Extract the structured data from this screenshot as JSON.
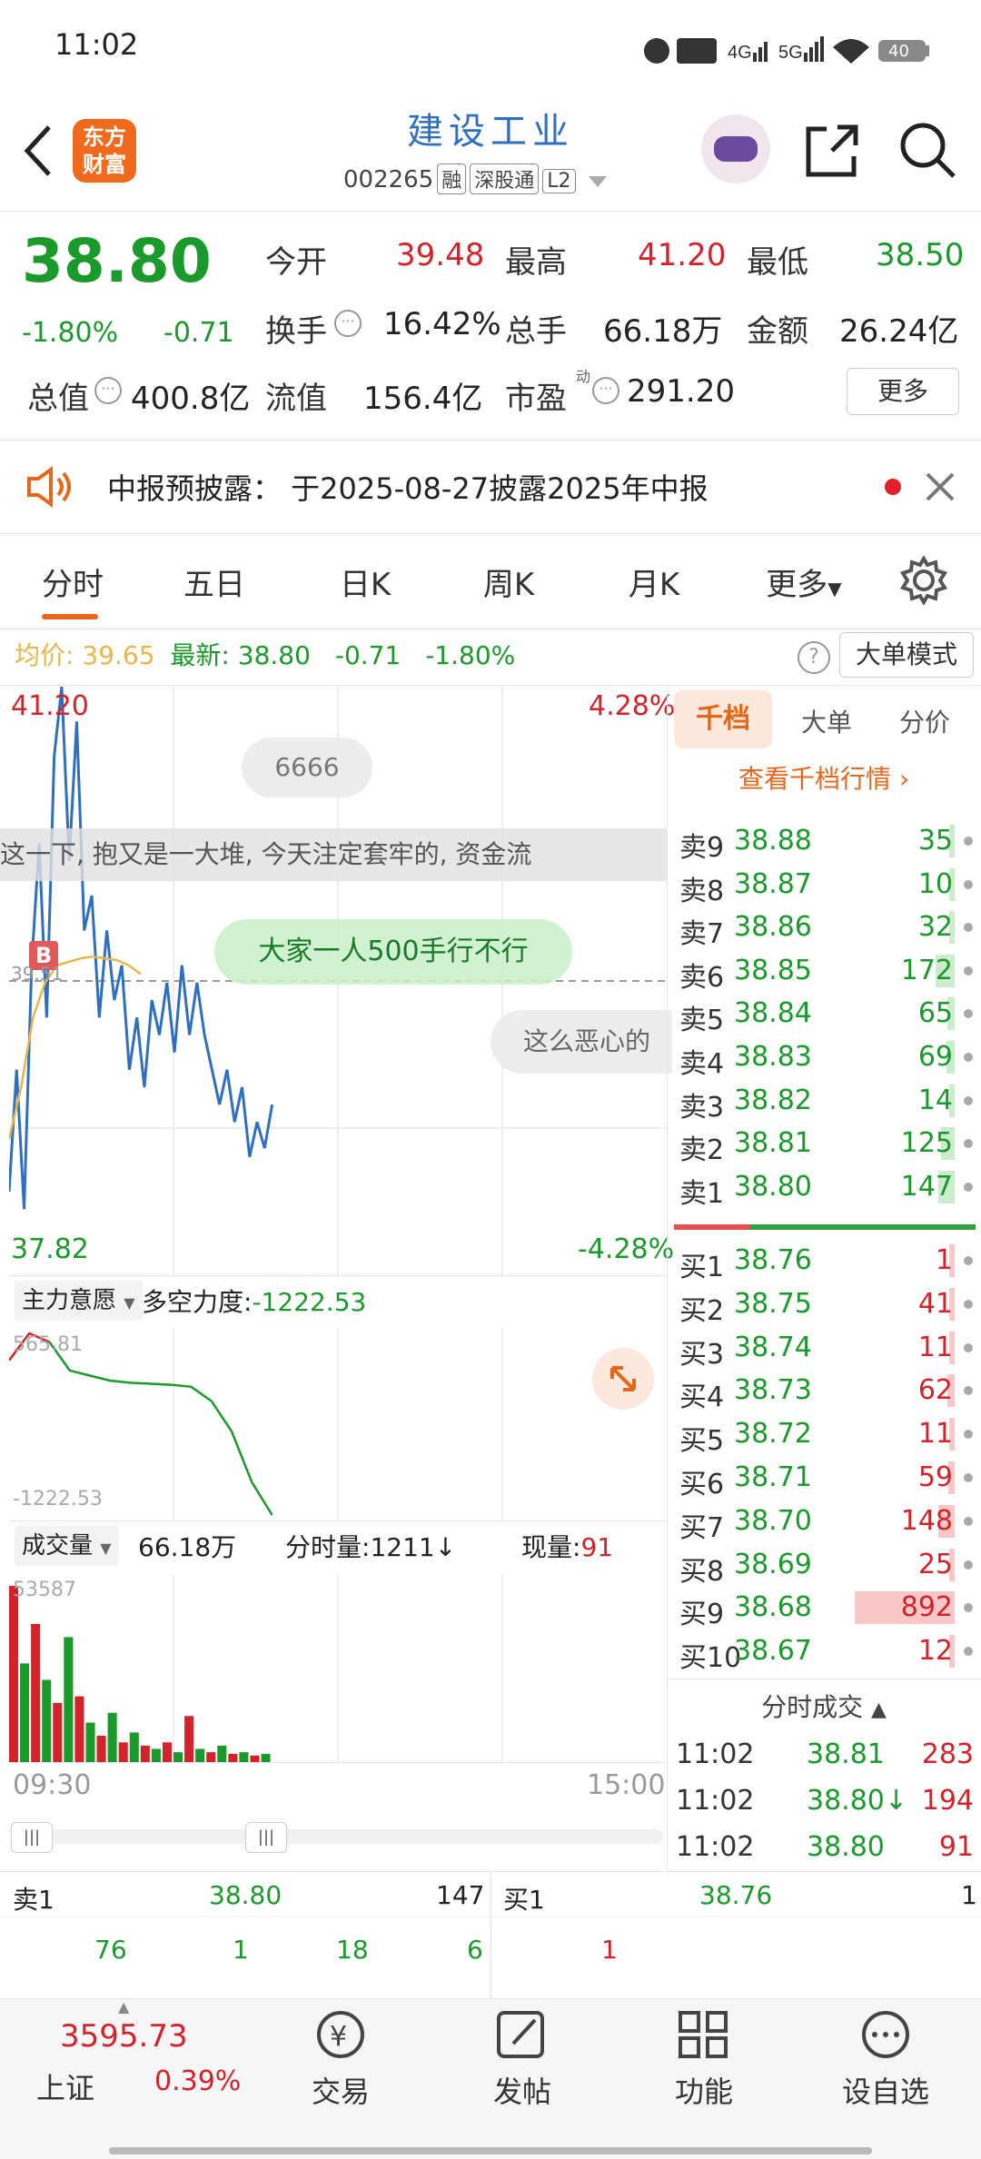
{
  "status": {
    "time": "11:02",
    "battery": "40"
  },
  "header": {
    "title": "建设工业",
    "code": "002265",
    "tags": [
      "融",
      "深股通",
      "L2"
    ],
    "logo_line1": "东方",
    "logo_line2": "财富"
  },
  "quote": {
    "price": "38.80",
    "change_pct": "-1.80%",
    "change": "-0.71",
    "open_label": "今开",
    "open": "39.48",
    "high_label": "最高",
    "high": "41.20",
    "low_label": "最低",
    "low": "38.50",
    "turnover_label": "换手",
    "turnover": "16.42%",
    "volume_label": "总手",
    "volume": "66.18万",
    "amount_label": "金额",
    "amount": "26.24亿",
    "mktcap_label": "总值",
    "mktcap": "400.8亿",
    "float_label": "流值",
    "float": "156.4亿",
    "pe_label": "市盈",
    "pe_sup": "动",
    "pe": "291.20",
    "more_button": "更多"
  },
  "notice": {
    "text": "中报预披露： 于2025-08-27披露2025年中报"
  },
  "tabs": {
    "items": [
      "分时",
      "五日",
      "日K",
      "周K",
      "月K",
      "更多"
    ],
    "active": "分时"
  },
  "info_line": {
    "avg_label": "均价:",
    "avg": "39.65",
    "latest_label": "最新:",
    "latest": "38.80",
    "chg": "-0.71",
    "pct": "-1.80%",
    "mode_button": "大单模式"
  },
  "chart": {
    "high_label": "41.20",
    "high_pct": "4.28%",
    "low_label": "37.82",
    "low_pct": "-4.28%",
    "mid_label": "39.51",
    "danmaku": [
      "6666",
      "这一下, 抱又是一大堆, 今天注定套牢的, 资金流",
      "大家一人500手行不行",
      "这么恶心的"
    ],
    "marker": "B"
  },
  "chart_data": [
    {
      "type": "line",
      "title": "",
      "xlabel": "",
      "ylabel": "",
      "x": [
        "09:30",
        "15:00"
      ],
      "ylim": [
        37.82,
        41.2
      ],
      "series": [
        {
          "name": "价格",
          "values": [
            38.3,
            39.0,
            38.2,
            39.6,
            40.3,
            39.3,
            40.8,
            41.2,
            40.2,
            41.0,
            39.8,
            40.0,
            39.3,
            39.8,
            39.4,
            39.6,
            39.0,
            39.3,
            38.9,
            39.4,
            39.2,
            39.5,
            39.1,
            39.6,
            39.2,
            39.5,
            39.2,
            39.0,
            38.8,
            39.0,
            38.7,
            38.9,
            38.5,
            38.7,
            38.55,
            38.8
          ]
        },
        {
          "name": "均价",
          "values": [
            38.6,
            38.9,
            39.3,
            39.5,
            39.6,
            39.62,
            39.64,
            39.65,
            39.64,
            39.63,
            39.6,
            39.55
          ]
        }
      ]
    },
    {
      "type": "line",
      "title": "多空力度",
      "ylim": [
        -1222.53,
        565.81
      ],
      "series": [
        {
          "name": "多空力度",
          "values": [
            300,
            565.81,
            480,
            200,
            150,
            100,
            80,
            70,
            60,
            40,
            -100,
            -400,
            -900,
            -1222.53
          ]
        }
      ]
    },
    {
      "type": "bar",
      "title": "成交量",
      "ylim": [
        0,
        53587
      ],
      "series": [
        {
          "name": "成交量",
          "values": [
            53587,
            30000,
            42000,
            25000,
            18000,
            38000,
            20000,
            12000,
            8000,
            15000,
            6000,
            9000,
            5000,
            4000,
            6000,
            3000,
            14000,
            4000,
            3000,
            5000,
            2500,
            3000,
            2000,
            2500
          ]
        }
      ]
    }
  ],
  "force": {
    "label": "主力意愿",
    "text": "多空力度:",
    "value": "-1222.53",
    "top_value": "565.81",
    "bottom_value": "-1222.53"
  },
  "volume": {
    "label": "成交量",
    "total": "66.18万",
    "tick_label": "分时量:",
    "tick_value": "1211",
    "now_label": "现量:",
    "now_value": "91",
    "time_start": "09:30",
    "time_end": "15:00"
  },
  "orderbook": {
    "tabs": [
      "千档",
      "大单",
      "分价"
    ],
    "link": "查看千档行情",
    "asks": [
      {
        "label": "卖9",
        "price": "38.88",
        "vol": "35"
      },
      {
        "label": "卖8",
        "price": "38.87",
        "vol": "10"
      },
      {
        "label": "卖7",
        "price": "38.86",
        "vol": "32"
      },
      {
        "label": "卖6",
        "price": "38.85",
        "vol": "172"
      },
      {
        "label": "卖5",
        "price": "38.84",
        "vol": "65"
      },
      {
        "label": "卖4",
        "price": "38.83",
        "vol": "69"
      },
      {
        "label": "卖3",
        "price": "38.82",
        "vol": "14"
      },
      {
        "label": "卖2",
        "price": "38.81",
        "vol": "125"
      },
      {
        "label": "卖1",
        "price": "38.80",
        "vol": "147"
      }
    ],
    "bids": [
      {
        "label": "买1",
        "price": "38.76",
        "vol": "1"
      },
      {
        "label": "买2",
        "price": "38.75",
        "vol": "41"
      },
      {
        "label": "买3",
        "price": "38.74",
        "vol": "11"
      },
      {
        "label": "买4",
        "price": "38.73",
        "vol": "62"
      },
      {
        "label": "买5",
        "price": "38.72",
        "vol": "11"
      },
      {
        "label": "买6",
        "price": "38.71",
        "vol": "59"
      },
      {
        "label": "买7",
        "price": "38.70",
        "vol": "148"
      },
      {
        "label": "买8",
        "price": "38.69",
        "vol": "25"
      },
      {
        "label": "买9",
        "price": "38.68",
        "vol": "892"
      },
      {
        "label": "买10",
        "price": "38.67",
        "vol": "12"
      }
    ],
    "ticks_title": "分时成交",
    "ticks": [
      {
        "time": "11:02",
        "price": "38.81",
        "vol": "283"
      },
      {
        "time": "11:02",
        "price": "38.80↓",
        "vol": "194"
      },
      {
        "time": "11:02",
        "price": "38.80",
        "vol": "91"
      }
    ]
  },
  "bottom_quote": {
    "ask_label": "卖1",
    "ask_price": "38.80",
    "ask_vol": "147",
    "bid_label": "买1",
    "bid_price": "38.76",
    "bid_vol": "1",
    "row2": [
      "76",
      "1",
      "18",
      "6",
      "1"
    ]
  },
  "index": {
    "value": "3595.73",
    "name": "上证",
    "pct": "0.39%"
  },
  "nav": [
    "交易",
    "发帖",
    "功能",
    "设自选"
  ],
  "colors": {
    "up": "#d4222a",
    "down": "#1a9a2a",
    "accent": "#e8661a",
    "price_line": "#2f6fc0",
    "avg_line": "#e8b64a"
  }
}
